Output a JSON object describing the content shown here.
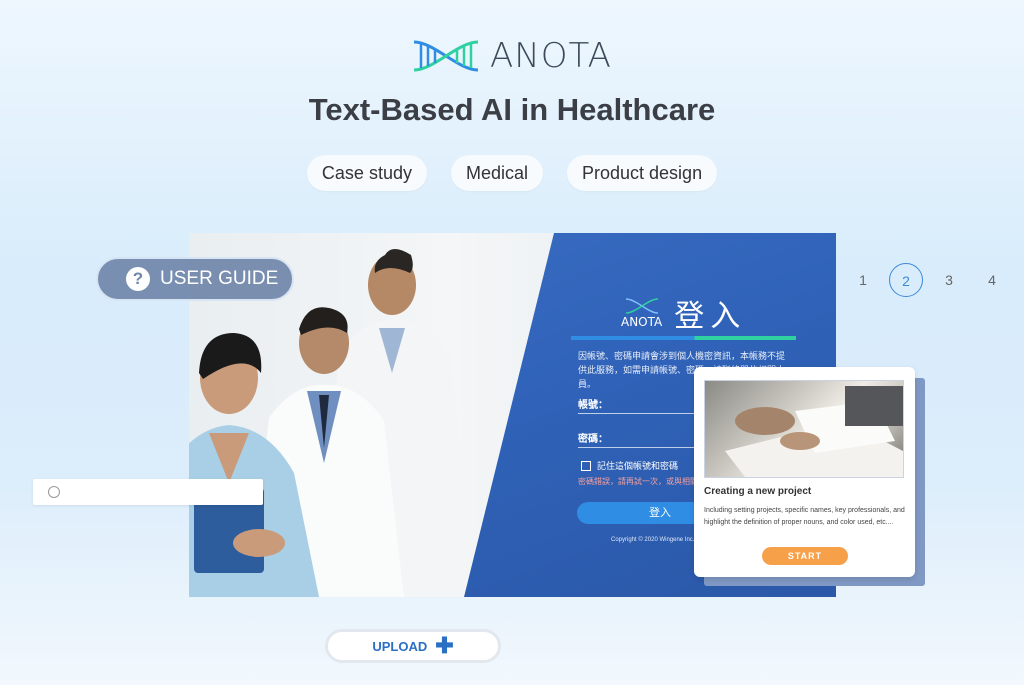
{
  "brand": {
    "name": "ANOTA"
  },
  "headline": "Text-Based AI in Healthcare",
  "tags": [
    "Case study",
    "Medical",
    "Product design"
  ],
  "showcase": {
    "login": {
      "logo_small": "ANOTA",
      "title": "登入",
      "note": "因帳號、密碼申請會涉到個人機密資訊，本帳務不提供此服務，如需申請帳號、密碼、請聯絡單位相關人員。",
      "account_label": "帳號：",
      "password_label": "密碼：",
      "remember_label": "記住這個帳號和密碼",
      "warning": "密碼錯誤，請再試一次，或與相關人員聯絡",
      "login_button": "登入",
      "copyright": "Copyright © 2020 Wingene Inc."
    }
  },
  "user_guide": {
    "label": "USER GUIDE",
    "icon": "question-circle-icon"
  },
  "pagination": {
    "pages": [
      "1",
      "2",
      "3",
      "4"
    ],
    "active": "2"
  },
  "card": {
    "title": "Creating a new project",
    "description": "Including setting projects, specific names, key professionals, and highlight the definition of proper nouns, and color used, etc....",
    "button": "START"
  },
  "upload": {
    "label": "UPLOAD",
    "icon": "plus-icon"
  },
  "colors": {
    "accent": "#2f8de4",
    "panel": "#2f62b8",
    "start": "#f6a04a",
    "teal": "#30d1a0"
  }
}
